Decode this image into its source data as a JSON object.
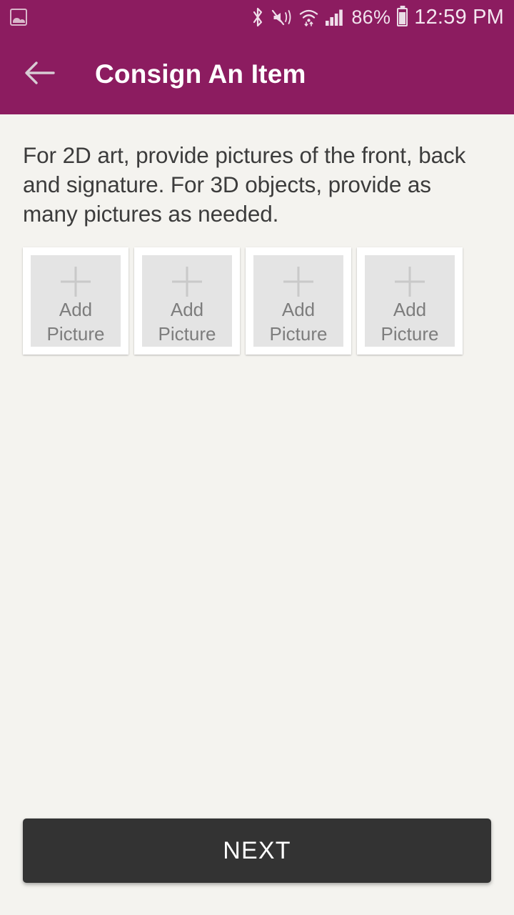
{
  "theme": {
    "primary_color": "#8C1C60",
    "status_bar_color": "#8C1C60",
    "background_color": "#F4F3EF",
    "button_color": "#333333",
    "card_color": "#FFFFFF",
    "card_inner_color": "#E4E4E4"
  },
  "status_bar": {
    "notification_icon": "gallery-image-icon",
    "icons": [
      "bluetooth-icon",
      "volume-mute-vibrate-icon",
      "wifi-icon",
      "cellular-signal-icon"
    ],
    "battery_percent": "86%",
    "battery_level": 86,
    "battery_icon": "battery-icon",
    "time": "12:59 PM"
  },
  "app_bar": {
    "back_icon": "arrow-left-icon",
    "title": "Consign An Item"
  },
  "main": {
    "instructions": "For 2D art, provide pictures of the front, back and signature. For 3D objects, provide as many pictures as needed.",
    "picture_slots": [
      {
        "icon": "plus-icon",
        "label_line1": "Add",
        "label_line2": "Picture"
      },
      {
        "icon": "plus-icon",
        "label_line1": "Add",
        "label_line2": "Picture"
      },
      {
        "icon": "plus-icon",
        "label_line1": "Add",
        "label_line2": "Picture"
      },
      {
        "icon": "plus-icon",
        "label_line1": "Add",
        "label_line2": "Picture"
      }
    ]
  },
  "footer": {
    "next_label": "NEXT"
  }
}
